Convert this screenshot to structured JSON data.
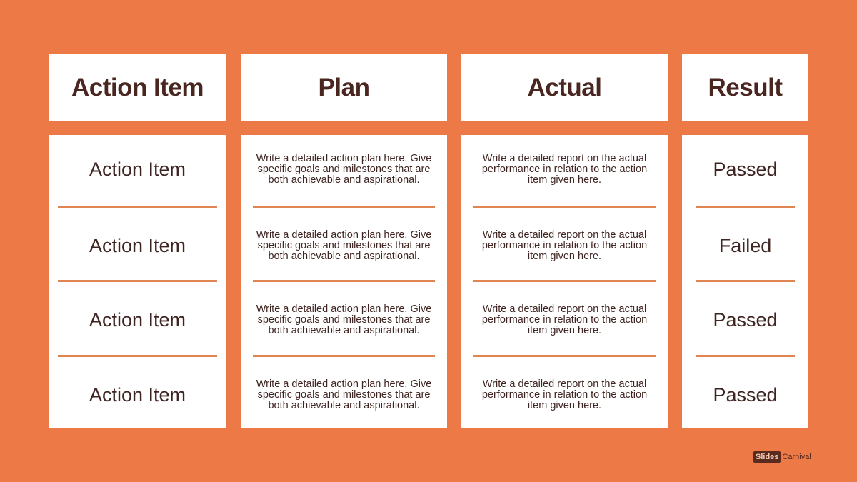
{
  "columns": [
    {
      "header": "Action Item"
    },
    {
      "header": "Plan"
    },
    {
      "header": "Actual"
    },
    {
      "header": "Result"
    }
  ],
  "rows": [
    {
      "action_item": "Action Item",
      "plan": "Write a detailed action plan here. Give specific goals and milestones that are both achievable and aspirational.",
      "actual": "Write a detailed report on the actual performance in relation to the action item given here.",
      "result": "Passed"
    },
    {
      "action_item": "Action Item",
      "plan": "Write a detailed action plan here. Give specific goals and milestones that are both achievable and aspirational.",
      "actual": "Write a detailed report on the actual performance in relation to the action item given here.",
      "result": "Failed"
    },
    {
      "action_item": "Action Item",
      "plan": "Write a detailed action plan here. Give specific goals and milestones that are both achievable and aspirational.",
      "actual": "Write a detailed report on the actual performance in relation to the action item given here.",
      "result": "Passed"
    },
    {
      "action_item": "Action Item",
      "plan": "Write a detailed action plan here. Give specific goals and milestones that are both achievable and aspirational.",
      "actual": "Write a detailed report on the actual performance in relation to the action item given here.",
      "result": "Passed"
    }
  ],
  "branding": {
    "part1": "Slides",
    "part2": "Carnival"
  },
  "colors": {
    "background": "#ED7A46",
    "panel": "#FFFFFF",
    "text": "#3F2522",
    "divider": "#E08454"
  }
}
